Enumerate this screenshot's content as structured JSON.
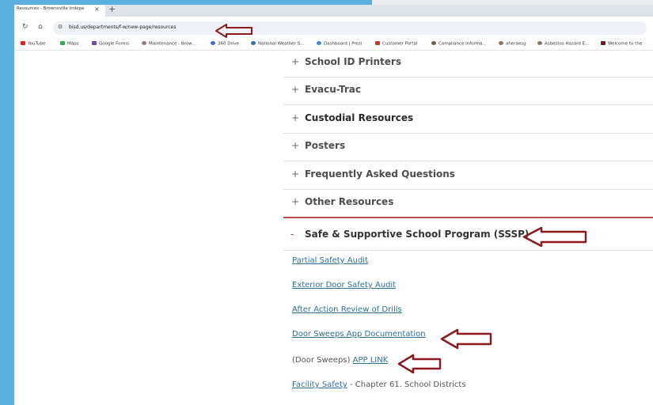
{
  "browser": {
    "tab_title": "Resources - Brownsville Indepe",
    "tab_close": "×",
    "new_tab": "+",
    "url": "bisd.us/departments/f-w/new-page/resources",
    "bookmarks": [
      {
        "label": "YouTube",
        "color": "#e62117"
      },
      {
        "label": "Maps",
        "color": "#34a853"
      },
      {
        "label": "Google Forms",
        "color": "#7248b9"
      },
      {
        "label": "Maintenance - Brow...",
        "color": "#9a7b7b"
      },
      {
        "label": "360 Drive",
        "color": "#3b6fd6"
      },
      {
        "label": "National Weather S...",
        "color": "#2a6fb8"
      },
      {
        "label": "Dashboard | Prezi",
        "color": "#3a8dde"
      },
      {
        "label": "Customer Portal",
        "color": "#c0392b"
      },
      {
        "label": "Compliance Informa...",
        "color": "#7a5c4a"
      },
      {
        "label": "aheraesg",
        "color": "#8b7766"
      },
      {
        "label": "Asbestos Hazard E...",
        "color": "#8b7766"
      },
      {
        "label": "Welcome to the",
        "color": "#6b1d24"
      }
    ]
  },
  "accordion": {
    "collapsed_marker": "+",
    "expanded_marker": "-",
    "items": [
      {
        "title": "School ID Printers"
      },
      {
        "title": "Evacu-Trac"
      },
      {
        "title": "Custodial Resources"
      },
      {
        "title": "Posters"
      },
      {
        "title": "Frequently Asked Questions"
      },
      {
        "title": "Other Resources"
      }
    ],
    "open_item": {
      "title": "Safe & Supportive School Program (SSSP)",
      "links": {
        "partial_audit": "Partial Safety Audit",
        "exterior_door": "Exterior Door Safety Audit",
        "after_action": "After Action Review of Drills",
        "door_sweeps_doc": "Door Sweeps App Documentation",
        "door_sweeps_prefix": "(Door Sweeps)",
        "app_link": "APP LINK",
        "facility_safety": "Facility Safety",
        "facility_suffix": "- Chapter 61. School Districts"
      }
    }
  },
  "colors": {
    "accent_red": "#c0393b",
    "link_blue": "#2f6f97",
    "arrow_red": "#8b1a1f",
    "desktop_blue": "#5bb0e0"
  }
}
